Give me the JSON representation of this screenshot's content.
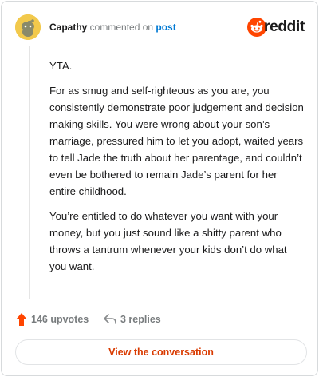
{
  "header": {
    "username": "Capathy",
    "action_text": " commented on ",
    "link_text": "post",
    "brand_word": "reddit",
    "avatar_icon": "snoo-avatar-icon",
    "brand_icon": "reddit-alien-icon",
    "colors": {
      "brand": "#ff4500",
      "link": "#0079d3",
      "avatar_bg": "#f2c94c"
    }
  },
  "comment": {
    "paragraphs": [
      "YTA.",
      "For as smug and self-righteous as you are, you consistently demonstrate poor judgement and decision making skills. You were wrong about your son’s marriage, pressured him to let you adopt, waited years to tell Jade the truth about her parentage, and couldn’t even be bothered to remain Jade’s parent for her entire childhood.",
      "You’re entitled to do whatever you want with your money, but you just sound like a shitty parent who throws a tantrum whenever your kids don’t do what you want."
    ]
  },
  "footer": {
    "upvotes_label": "146 upvotes",
    "replies_label": "3 replies",
    "upvote_icon": "upvote-arrow-icon",
    "reply_icon": "reply-arrow-icon",
    "view_button_label": "View the conversation",
    "colors": {
      "upvote": "#ff4500",
      "button_text": "#d93a00"
    }
  }
}
